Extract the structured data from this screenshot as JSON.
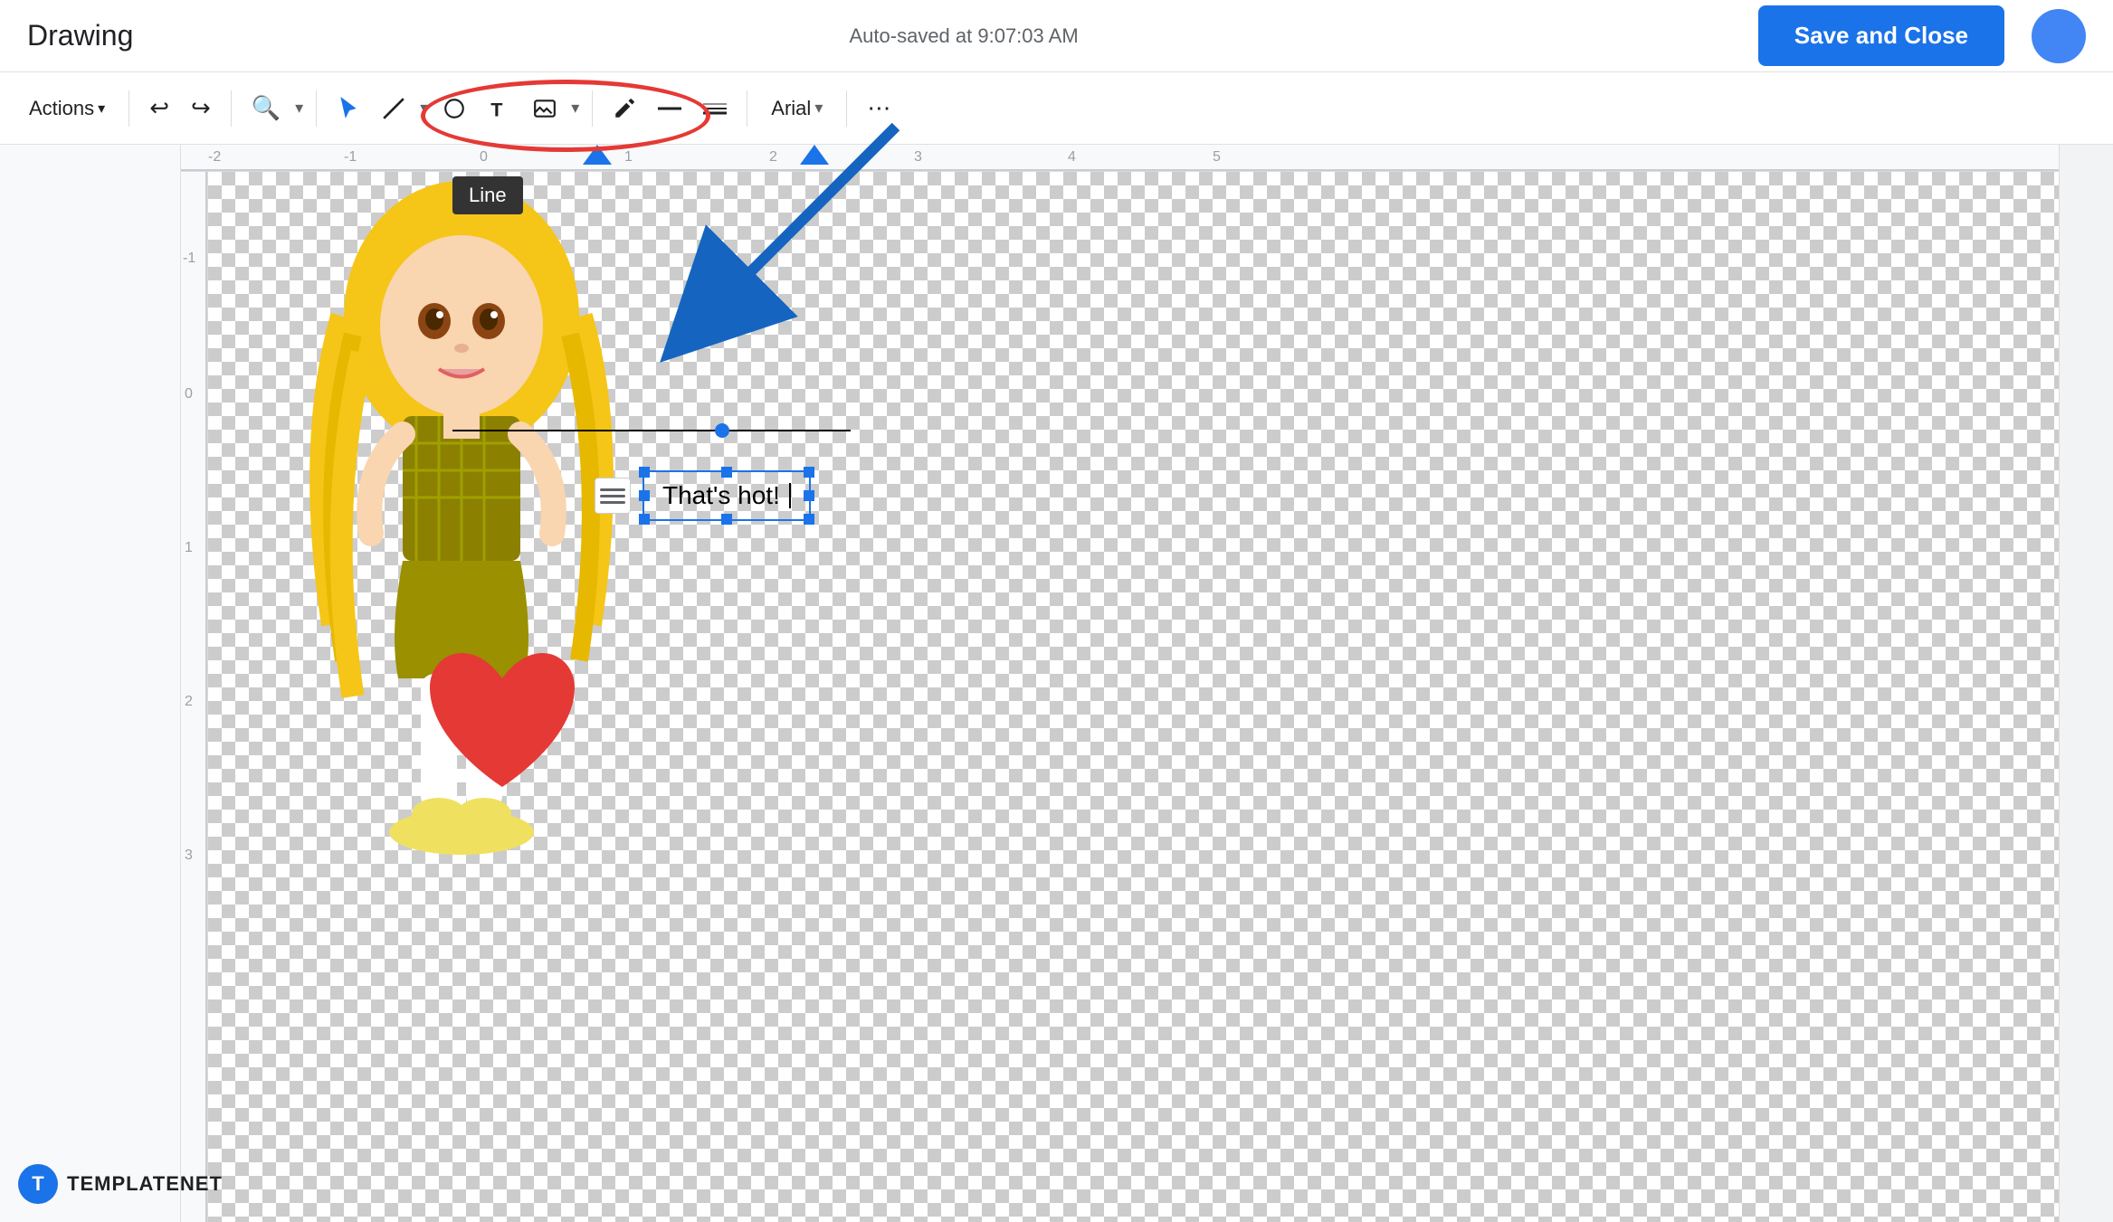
{
  "app": {
    "title": "Drawing",
    "autosave": "Auto-saved at 9:07:03 AM",
    "save_close_label": "Save and Close"
  },
  "toolbar": {
    "actions_label": "Actions",
    "font_label": "Arial",
    "line_tooltip": "Line",
    "more_options_label": "⋯"
  },
  "canvas": {
    "text_content": "That's hot!",
    "text_cursor": "|"
  },
  "branding": {
    "logo_letter": "T",
    "logo_text": "TEMPLATENET"
  },
  "ruler": {
    "labels": [
      "-2",
      "-1",
      "0",
      "1",
      "2",
      "3",
      "4",
      "5"
    ],
    "left_labels": [
      "-1",
      "0",
      "1",
      "2",
      "3"
    ]
  },
  "colors": {
    "accent_blue": "#1a73e8",
    "red_annotation": "#e53935",
    "arrow_blue": "#1565c0",
    "text_dark": "#202124",
    "toolbar_bg": "#ffffff",
    "canvas_bg": "#ffffff"
  }
}
